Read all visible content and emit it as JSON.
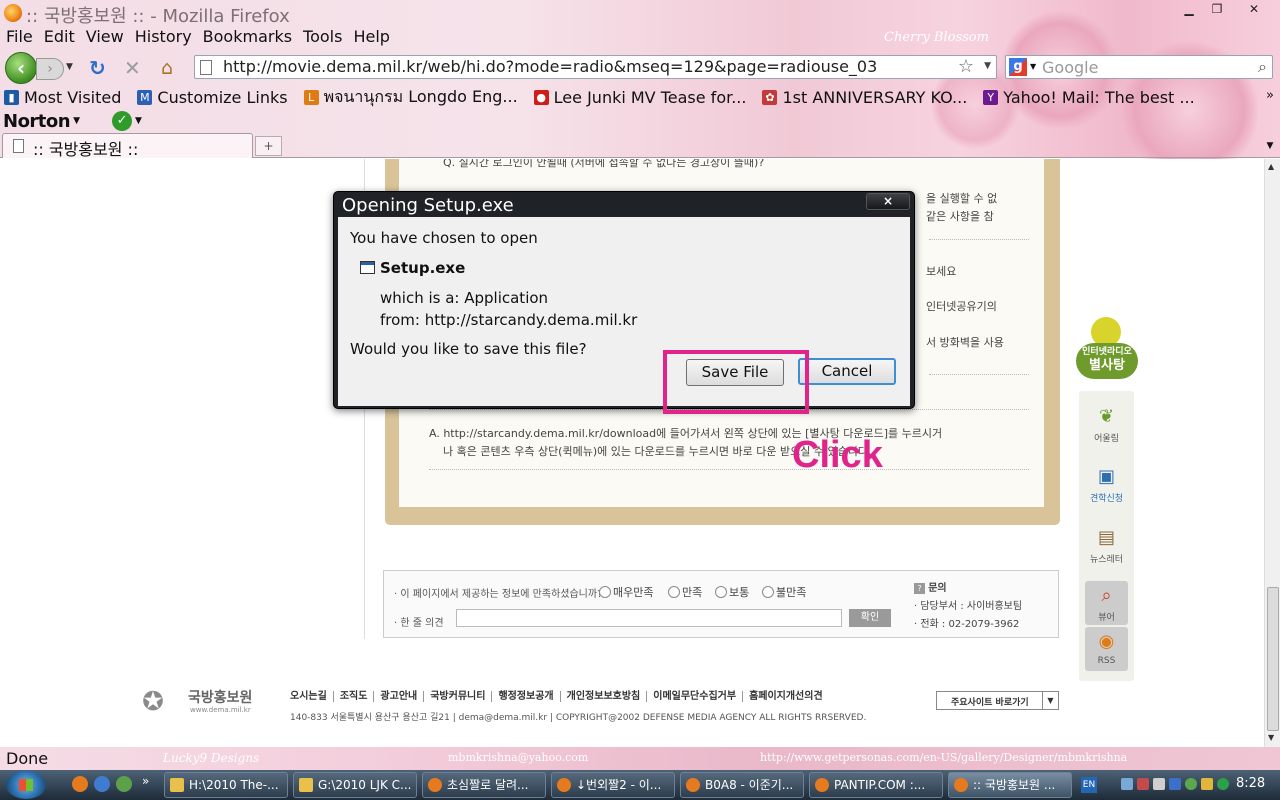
{
  "window": {
    "title": ":: 국방홍보원 :: - Mozilla Firefox",
    "persona_credit": "Cherry Blossom"
  },
  "menu": [
    "File",
    "Edit",
    "View",
    "History",
    "Bookmarks",
    "Tools",
    "Help"
  ],
  "nav": {
    "url": "http://movie.dema.mil.kr/web/hi.do?mode=radio&mseq=129&page=radiouse_03",
    "search_placeholder": "Google"
  },
  "bookmarks": [
    {
      "label": "Most Visited",
      "icon": "bookmark-star-icon",
      "color": "#1d5aa5"
    },
    {
      "label": "Customize Links",
      "icon": "customize-links-icon",
      "color": "#2d5fb5"
    },
    {
      "label": "พจนานุกรม Longdo Eng...",
      "icon": "longdo-icon",
      "color": "#e07a12"
    },
    {
      "label": "Lee Junki MV Tease for...",
      "icon": "youtube-icon",
      "color": "#d11b1b"
    },
    {
      "label": "1st ANNIVERSARY KO...",
      "icon": "ribbon-icon",
      "color": "#c43a3a"
    },
    {
      "label": "Yahoo! Mail: The best ...",
      "icon": "yahoo-icon",
      "color": "#6b1b8e"
    }
  ],
  "norton": {
    "label": "Norton"
  },
  "tab": {
    "title": ":: 국방홍보원 ::",
    "new_tab": "+"
  },
  "page": {
    "board_lines": [
      "Q. 실시간 로그인이 안될때 (서버에 접속할 수 없다는 경고창이 뜰때)?",
      "을 실행할 수 없",
      "같은 사항을 참",
      "보세요",
      "인터넷공유기의",
      "서 방화벽을 사용"
    ],
    "answer_line1": "A. http://starcandy.dema.mil.kr/download에 들어가셔서 왼쪽 상단에 있는 [별사탕 다운로드]를 누르시거",
    "answer_line2": "나 혹은 콘텐츠 우측 상단(퀵메뉴)에 있는 다운로드를 누르시면 바로 다운 받으실 수 있습니다.",
    "survey": {
      "question": "· 이 페이지에서 제공하는 정보에 만족하셨습니까?",
      "options": [
        "매우만족",
        "만족",
        "보통",
        "불만족"
      ],
      "opinion_label": "· 한 줄 의견",
      "submit": "확인",
      "contact_title": "문의",
      "dept": "· 담당부서 : 사이버홍보팀",
      "phone": "· 전화 : 02-2079-3962"
    },
    "footer": {
      "logo_name": "국방홍보원",
      "logo_sub": "www.dema.mil.kr",
      "links": [
        "오시는길",
        "조직도",
        "광고안내",
        "국방커뮤니티",
        "행정정보공개",
        "개인정보보호방침",
        "이메일무단수집거부",
        "홈페이지개선의견"
      ],
      "address": "140-833 서울특별시 용산구 용산고 길21  |  dema@dema.mil.kr  |  COPYRIGHT@2002 DEFENSE MEDIA AGENCY ALL RIGHTS RRSERVED.",
      "site_select": "주요사이트 바로가기"
    },
    "radio_badge": {
      "line1": "인터넷라디오",
      "line2": "별사탕"
    },
    "quick_menu": [
      {
        "label": "어울림",
        "icon": "sprout-icon"
      },
      {
        "label": "견학신청",
        "icon": "tv-icon"
      },
      {
        "label": "뉴스레터",
        "icon": "newsletter-icon"
      },
      {
        "label": "뷰어",
        "icon": "viewer-icon"
      },
      {
        "label": "RSS",
        "icon": "rss-icon"
      }
    ]
  },
  "dialog": {
    "title": "Opening Setup.exe",
    "close": "×",
    "chosen": "You have chosen to open",
    "filename": "Setup.exe",
    "which_is": "which is a:  Application",
    "from": "from:  http://starcandy.dema.mil.kr",
    "question": "Would you like to save this file?",
    "save_button": "Save File",
    "cancel_button": "Cancel"
  },
  "annotation": {
    "text": "Click",
    "color": "#e0248c"
  },
  "status": {
    "text": "Done",
    "credit_designs": "Lucky9 Designs",
    "credit_email": "mbmkrishna@yahoo.com",
    "credit_url": "http://www.getpersonas.com/en-US/gallery/Designer/mbmkrishna"
  },
  "taskbar": {
    "tasks": [
      {
        "label": "H:\\2010 The-...",
        "icon": "folder-icon",
        "color": "#e8c04b"
      },
      {
        "label": "G:\\2010 LJK C...",
        "icon": "folder-icon",
        "color": "#e8c04b"
      },
      {
        "label": "초심짤로 달려...",
        "icon": "firefox-icon",
        "color": "#e67a1e"
      },
      {
        "label": "↓번외짤2 - 이...",
        "icon": "firefox-icon",
        "color": "#e67a1e"
      },
      {
        "label": "B0A8 - 이준기...",
        "icon": "firefox-icon",
        "color": "#e67a1e"
      },
      {
        "label": "PANTIP.COM :...",
        "icon": "firefox-icon",
        "color": "#e67a1e"
      },
      {
        "label": ":: 국방홍보원 ...",
        "icon": "firefox-icon",
        "color": "#e67a1e"
      }
    ],
    "lang": "EN",
    "clock": "8:28"
  }
}
